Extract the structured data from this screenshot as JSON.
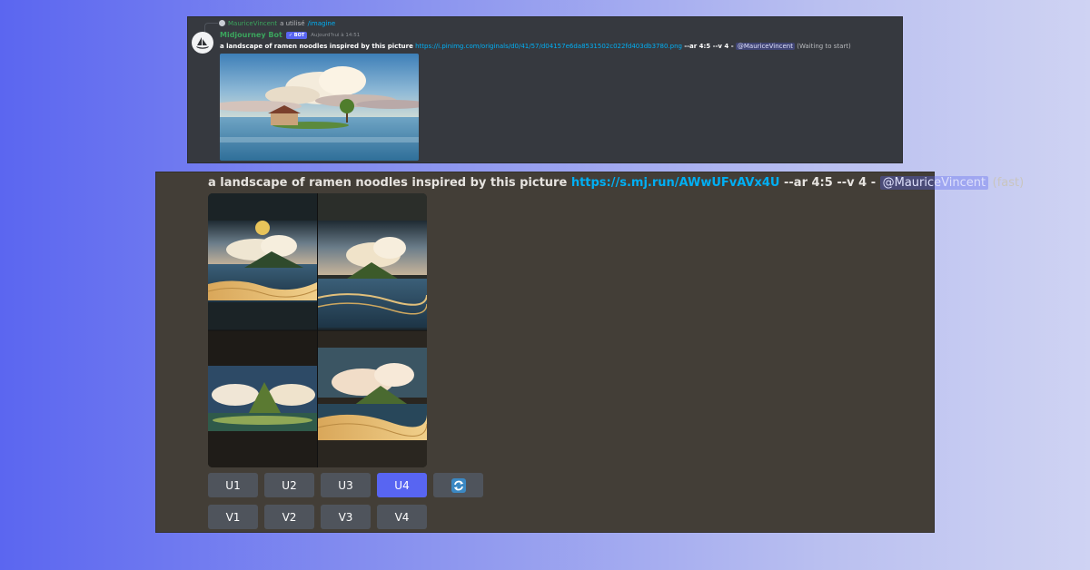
{
  "top_panel": {
    "reply": {
      "user": "MauriceVincent",
      "used_text": "a utilisé",
      "command": "/imagine"
    },
    "bot": {
      "name": "Midjourney Bot",
      "tag": "✓ BOT",
      "timestamp": "Aujourd'hui à 14:51"
    },
    "message": {
      "prompt": "a landscape of ramen noodles inspired by this picture",
      "link": "https://i.pinimg.com/originals/d0/41/57/d04157e6da8531502c022fd403db3780.png",
      "params": "--ar 4:5 --v 4 -",
      "mention": "@MauriceVincent",
      "status": "(Waiting to start)"
    }
  },
  "bottom_panel": {
    "message": {
      "prompt": "a landscape of ramen noodles inspired by this picture",
      "link": "https://s.mj.run/AWwUFvAVx4U",
      "params": "--ar 4:5 --v 4 -",
      "mention": "@MauriceVincent",
      "status": "(fast)"
    },
    "upscale_buttons": [
      "U1",
      "U2",
      "U3",
      "U4"
    ],
    "variation_buttons": [
      "V1",
      "V2",
      "V3",
      "V4"
    ],
    "active_button": "U4",
    "refresh_icon": "refresh-icon"
  },
  "colors": {
    "accent": "#5865f2",
    "link": "#00aff4",
    "bot_name": "#3ba55d",
    "button": "#4f545c"
  }
}
